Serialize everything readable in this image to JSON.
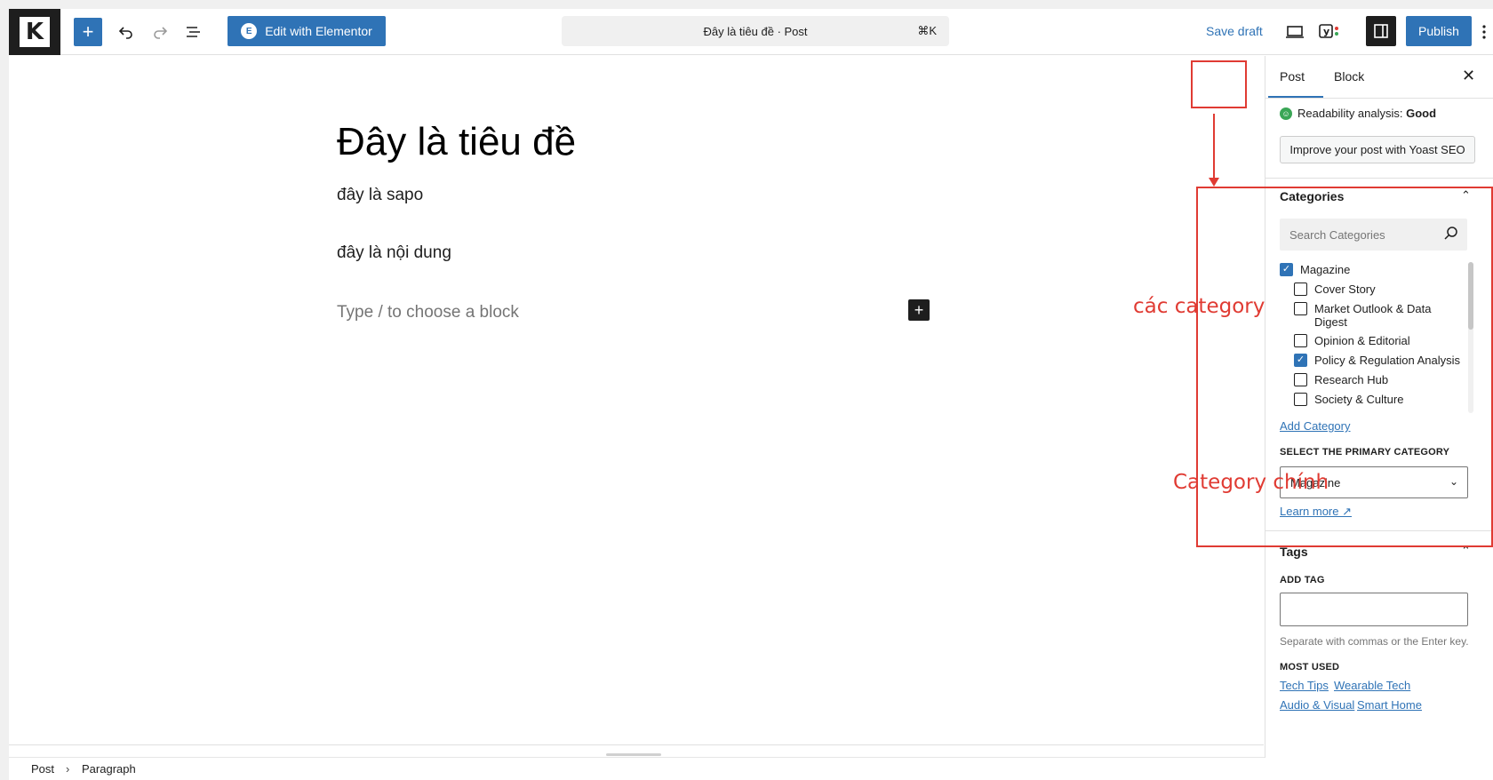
{
  "app": {
    "logo_letter": "K"
  },
  "toolbar": {
    "elementor_label": "Edit with Elementor",
    "doc_title": "Đây là tiêu đề · Post",
    "shortcut": "⌘K",
    "save_draft": "Save draft",
    "publish": "Publish"
  },
  "editor": {
    "title": "Đây là tiêu đề",
    "paragraphs": [
      "đây là sapo",
      "đây là nội dung"
    ],
    "placeholder": "Type / to choose a block"
  },
  "breadcrumb": {
    "items": [
      "Post",
      "Paragraph"
    ]
  },
  "sidebar": {
    "tabs": [
      "Post",
      "Block"
    ],
    "readability_label": "Readability analysis: ",
    "readability_value": "Good",
    "yoast_button": "Improve your post with Yoast SEO",
    "categories": {
      "title": "Categories",
      "search_placeholder": "Search Categories",
      "items": [
        {
          "label": "Magazine",
          "checked": true,
          "level": 0
        },
        {
          "label": "Cover Story",
          "checked": false,
          "level": 1
        },
        {
          "label": "Market Outlook & Data Digest",
          "checked": false,
          "level": 1
        },
        {
          "label": "Opinion & Editorial",
          "checked": false,
          "level": 1
        },
        {
          "label": "Policy & Regulation Analysis",
          "checked": true,
          "level": 1
        },
        {
          "label": "Research Hub",
          "checked": false,
          "level": 1
        },
        {
          "label": "Society & Culture",
          "checked": false,
          "level": 1
        }
      ],
      "add_link": "Add Category",
      "primary_label": "SELECT THE PRIMARY CATEGORY",
      "primary_value": "Magazine",
      "learn_more": "Learn more ↗"
    },
    "tags": {
      "title": "Tags",
      "add_label": "ADD TAG",
      "help": "Separate with commas or the Enter key.",
      "most_used_label": "MOST USED",
      "most_used": [
        "Tech Tips",
        "Wearable Tech",
        "Audio & Visual",
        "Smart Home"
      ]
    }
  },
  "annotations": {
    "categories_note": "các category",
    "primary_note": "Category chính",
    "color": "#e03b33"
  },
  "colors": {
    "accent": "#2f73b6",
    "dark": "#1e1e1e"
  }
}
